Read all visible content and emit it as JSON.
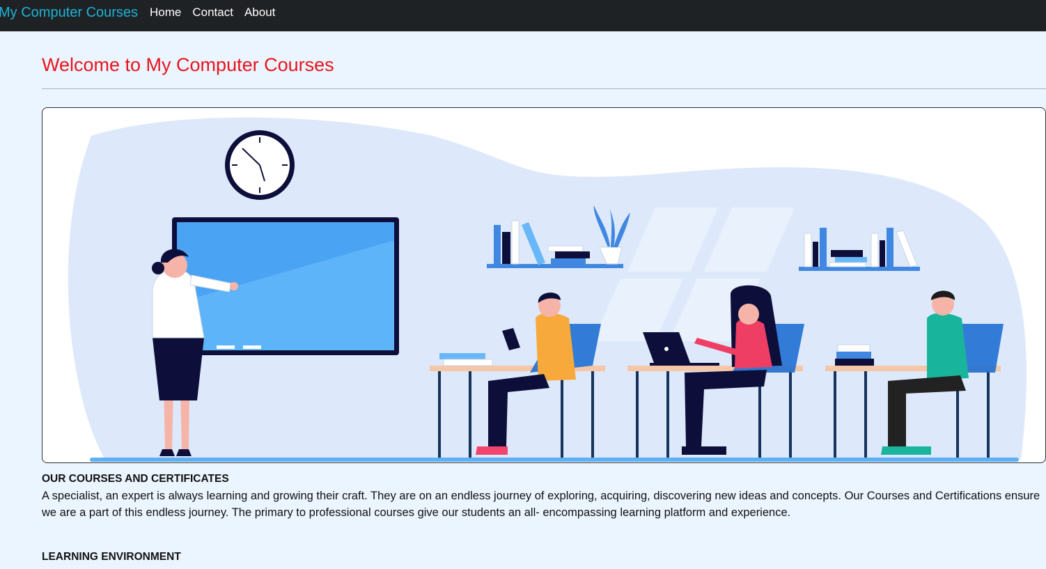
{
  "nav": {
    "brand": "My Computer Courses",
    "links": [
      "Home",
      "Contact",
      "About"
    ]
  },
  "page": {
    "title": "Welcome to My Computer Courses"
  },
  "hero": {
    "image_alt": "classroom-illustration"
  },
  "sections": [
    {
      "heading": "OUR COURSES AND CERTIFICATES",
      "body": "A specialist, an expert is always learning and growing their craft. They are on an endless journey of exploring, acquiring, discovering new ideas and concepts. Our Courses and Certifications ensure we are a part of this endless journey. The primary to professional courses give our students an all- encompassing learning platform and experience."
    },
    {
      "heading": "LEARNING ENVIRONMENT"
    }
  ],
  "colors": {
    "navbar": "#1f2225",
    "brand": "#1eb2d6",
    "title": "#e8141c",
    "page_bg": "#ebf5ff"
  }
}
